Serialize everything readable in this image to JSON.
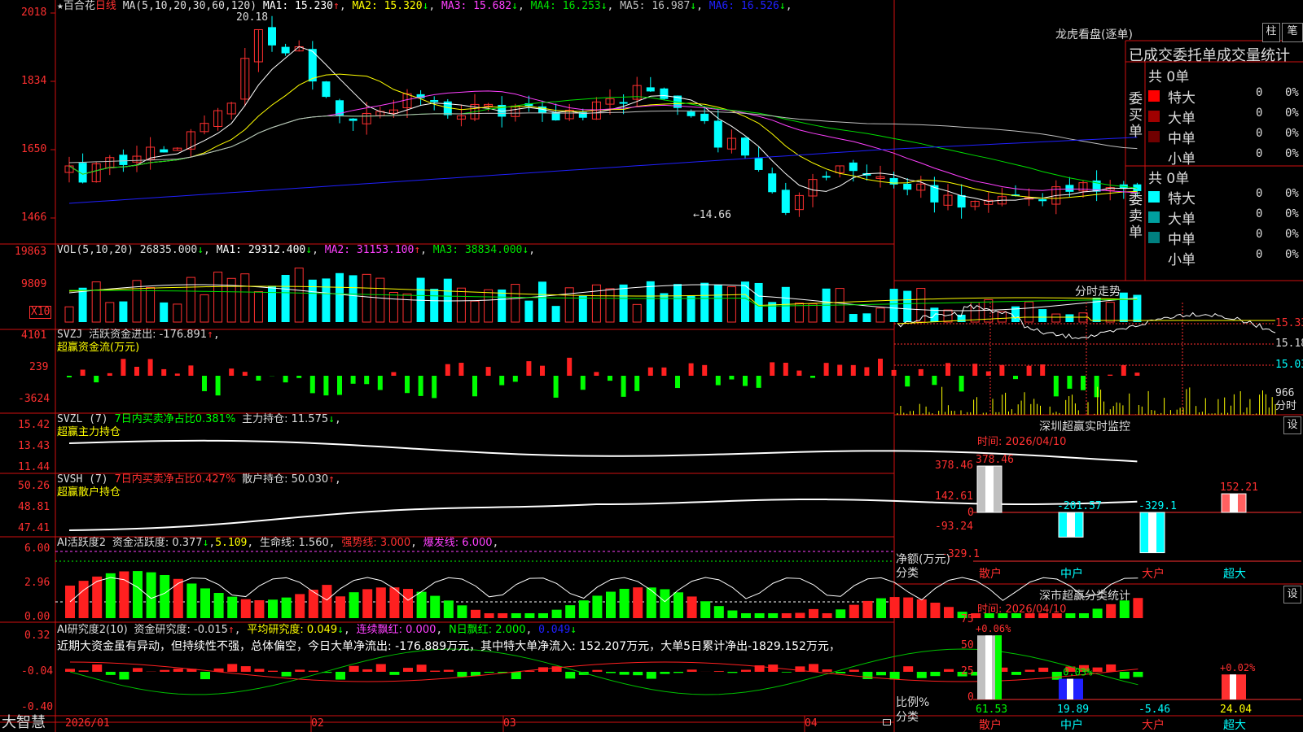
{
  "app": {
    "logo": "大智慧",
    "lock_icon": "lock-icon"
  },
  "header": {
    "star": "★",
    "stock_name": "百合花",
    "period": "日线",
    "ma_label": "MA(5,10,20,30,60,120)",
    "ma_values": [
      {
        "name": "MA1:",
        "value": "15.230",
        "arrow": "↑",
        "color": "#ffffff"
      },
      {
        "name": "MA2:",
        "value": "15.320",
        "arrow": "↓",
        "color": "#ffff00"
      },
      {
        "name": "MA3:",
        "value": "15.682",
        "arrow": "↓",
        "color": "#ff40ff"
      },
      {
        "name": "MA4:",
        "value": "16.253",
        "arrow": "↓",
        "color": "#00e000"
      },
      {
        "name": "MA5:",
        "value": "16.987",
        "arrow": "↓",
        "color": "#c0c0c0"
      },
      {
        "name": "MA6:",
        "value": "16.526",
        "arrow": "↓",
        "color": "#2020ff"
      }
    ],
    "high_mark": "20.18",
    "low_mark": "←14.66"
  },
  "price_axis": [
    "2018",
    "1834",
    "1650",
    "1466"
  ],
  "vol": {
    "label": "VOL(5,10,20)",
    "value": "26835.000",
    "value_arrow": "↓",
    "ma": [
      {
        "name": "MA1:",
        "value": "29312.400",
        "arrow": "↓",
        "color": "#ffffff"
      },
      {
        "name": "MA2:",
        "value": "31153.100",
        "arrow": "↑",
        "color": "#ff40ff"
      },
      {
        "name": "MA3:",
        "value": "38834.000",
        "arrow": "↓",
        "color": "#00e000"
      }
    ],
    "axis": [
      "19863",
      "9809"
    ],
    "unit": "X10"
  },
  "svzj": {
    "title": "SVZJ",
    "line1": "活跃资金进出: -176.891",
    "arrow": "↑",
    "line2": "超赢资金流(万元)",
    "axis": [
      "4101",
      "239",
      "-3624"
    ]
  },
  "svzl": {
    "title": "SVZL (7)",
    "part1": "7日内买卖净占比0.381%",
    "part2": "主力持仓: 11.575",
    "arrow": "↓",
    "line2": "超赢主力持仓",
    "axis": [
      "15.42",
      "13.43",
      "11.44"
    ]
  },
  "svsh": {
    "title": "SVSH (7)",
    "part1": "7日内买卖净占比0.427%",
    "part2": "散户持仓: 50.030",
    "arrow": "↑",
    "line2": "超赢散户持仓",
    "axis": [
      "50.26",
      "48.81",
      "47.41"
    ]
  },
  "ai1": {
    "title": "AI活跃度2",
    "p1": "资金活跃度: 0.377",
    "a1": "↓",
    "p1b": "5.109",
    "p2": "生命线: 1.560",
    "p3": "强势线: 3.000",
    "p4": "爆发线: 6.000",
    "axis": [
      "6.00",
      "2.96",
      "0.00"
    ]
  },
  "ai2": {
    "title": "AI研究度2(10)",
    "p1": "资金研究度: -0.015",
    "a1": "↑",
    "p2": "平均研究度: 0.049",
    "a2": "↓",
    "p3": "连续飘红: 0.000",
    "p4": "N日飘红: 2.000",
    "p5": "0.049",
    "a5": "↓",
    "comment": "近期大资金虽有异动，但持续性不强，总体偏空，今日大单净流出: -176.889万元，其中特大单净流入: 152.207万元，大单5日累计净出-1829.152万元，",
    "axis": [
      "0.32",
      "-0.04",
      "-0.40"
    ]
  },
  "date_axis": [
    "2026/01",
    "02",
    "03",
    "04"
  ],
  "right": {
    "lhb_title": "龙虎看盘(逐单)",
    "btn1": "柱",
    "btn2": "笔",
    "table_title": "已成交委托单成交量统计",
    "buy_label": "委买单",
    "sell_label": "委卖单",
    "buy_total": "共 0单",
    "sell_total": "共 0单",
    "rows": [
      {
        "name": "特大",
        "count": "0",
        "pct": "0%"
      },
      {
        "name": "大单",
        "count": "0",
        "pct": "0%"
      },
      {
        "name": "中单",
        "count": "0",
        "pct": "0%"
      },
      {
        "name": "小单",
        "count": "0",
        "pct": "0%"
      }
    ],
    "buy_colors": [
      "#ff0000",
      "#a00000",
      "#700000",
      ""
    ],
    "sell_colors": [
      "#00ffff",
      "#00a0a0",
      "#008080",
      ""
    ],
    "intraday_title": "分时走势",
    "intraday_axis": [
      "15.33",
      "15.18",
      "15.03"
    ],
    "intraday_vol": "966",
    "intraday_vol_unit": "分时",
    "monitor_title": "深圳超赢实时监控",
    "monitor_settings": "设",
    "monitor_time": "时间: 2026/04/10",
    "monitor_axis": [
      "378.46",
      "142.61",
      "0",
      "-93.24",
      "-329.1"
    ],
    "monitor_unit": "净额(万元)",
    "monitor_cat": "分类",
    "stats_title": "深市超赢分类统计",
    "stats_settings": "设",
    "stats_time": "时间: 2026/04/10",
    "stats_axis": [
      "75",
      "50",
      "25",
      "0"
    ],
    "stats_unit": "比例%",
    "stats_cat": "分类"
  },
  "chart_data": [
    {
      "type": "bar",
      "title": "深圳超赢实时监控",
      "categories": [
        "散户",
        "中户",
        "大户",
        "超大"
      ],
      "values": [
        378.46,
        -201.57,
        -329.1,
        152.21
      ],
      "ylabel": "净额(万元)",
      "ylim": [
        -329.1,
        378.46
      ]
    },
    {
      "type": "bar",
      "title": "深市超赢分类统计",
      "categories": [
        "散户",
        "中户",
        "大户",
        "超大"
      ],
      "values": [
        61.53,
        19.89,
        -5.46,
        24.04
      ],
      "changes": [
        "+0.06%",
        "-0.03%",
        "",
        "+0.02%"
      ],
      "ylabel": "比例%",
      "ylim": [
        0,
        75
      ]
    }
  ]
}
